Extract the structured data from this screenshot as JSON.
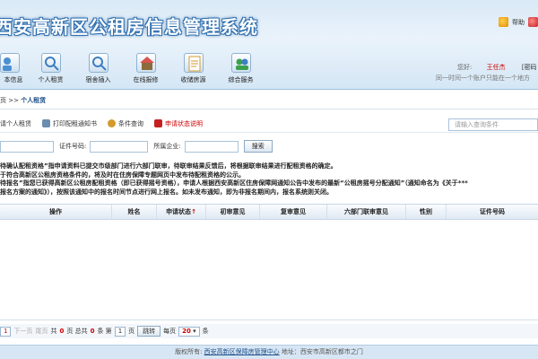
{
  "app": {
    "title": "西安高新区公租房信息管理系统"
  },
  "header_links": {
    "help": "帮助",
    "pwd": "[密码"
  },
  "nav": [
    {
      "label": "本信息",
      "icon": "person-info-icon"
    },
    {
      "label": "个人租赁",
      "icon": "person-search-icon"
    },
    {
      "label": "宿舍插入",
      "icon": "dorm-search-icon"
    },
    {
      "label": "在线报修",
      "icon": "house-repair-icon"
    },
    {
      "label": "收储房源",
      "icon": "document-icon"
    },
    {
      "label": "综合服务",
      "icon": "service-icon"
    }
  ],
  "welcome": {
    "greeting": "您好:",
    "user": "王任杰",
    "pwd_link": "[密码",
    "notice": "同一时间一个账户只能在一个地方"
  },
  "breadcrumb": {
    "prefix": "页 >> ",
    "current": "个人租赁"
  },
  "toolbar": {
    "items": [
      {
        "label": "请个人租赁",
        "icon": "add-icon",
        "red": false
      },
      {
        "label": "打印配租通知书",
        "icon": "print-icon",
        "red": false
      },
      {
        "label": "条件查询",
        "icon": "filter-icon",
        "red": false
      },
      {
        "label": "申请状态说明",
        "icon": "info-icon",
        "red": true
      }
    ],
    "search_placeholder": "请输入查询条件"
  },
  "filter": {
    "id_label": "证件号码:",
    "company_label": "所属企业:",
    "search_btn": "搜索"
  },
  "notice_lines": [
    "待确认配租资格”指申请资料已提交市级部门进行六部门联审，待联审结果反馈后，将根据联审结果进行配租资格的确定。",
    "于符合高新区公租房资格条件的，将及时在住房保障专题网页中发布待配租资格的公示。",
    "待报名”指您已获得高新区公租房配租资格（即已获得摇号资格），申请人根据西安高新区住房保障网通知公告中发布的最新“公租房摇号分配通知”（通知命名为《关于***",
    "报名方案的通知》），按照该通知中的报名时间节点进行网上报名。如未发布通知，即为非报名期间内，报名系统则关闭。"
  ],
  "table": {
    "columns": [
      {
        "label": "操作",
        "sort": ""
      },
      {
        "label": "姓名",
        "sort": ""
      },
      {
        "label": "申请状态",
        "sort": "↑"
      },
      {
        "label": "初审意见",
        "sort": ""
      },
      {
        "label": "复审意见",
        "sort": ""
      },
      {
        "label": "六部门联审意见",
        "sort": ""
      },
      {
        "label": "性别",
        "sort": ""
      },
      {
        "label": "证件号码",
        "sort": ""
      }
    ],
    "rows": []
  },
  "pager": {
    "page": "1",
    "next": "下一页",
    "last": "尾页",
    "total_prefix": "共",
    "total_pages": "0",
    "pages_unit": "页 总共",
    "total_records": "0",
    "records_unit": "条 第",
    "goto_page": "1",
    "page_unit": "页",
    "goto_btn": "跳转",
    "per_prefix": "每页",
    "per_page": "20",
    "per_unit": "条"
  },
  "footer": {
    "prefix": "版权所有:",
    "org": "西安高新区保障房管理中心",
    "addr": "地址：西安市高新区都市之门"
  },
  "colors": {
    "header_bg": "#d9e9f7",
    "title_stroke": "#2f6fb0",
    "accent_red": "#cc0000",
    "link_blue": "#1f4f8a"
  }
}
